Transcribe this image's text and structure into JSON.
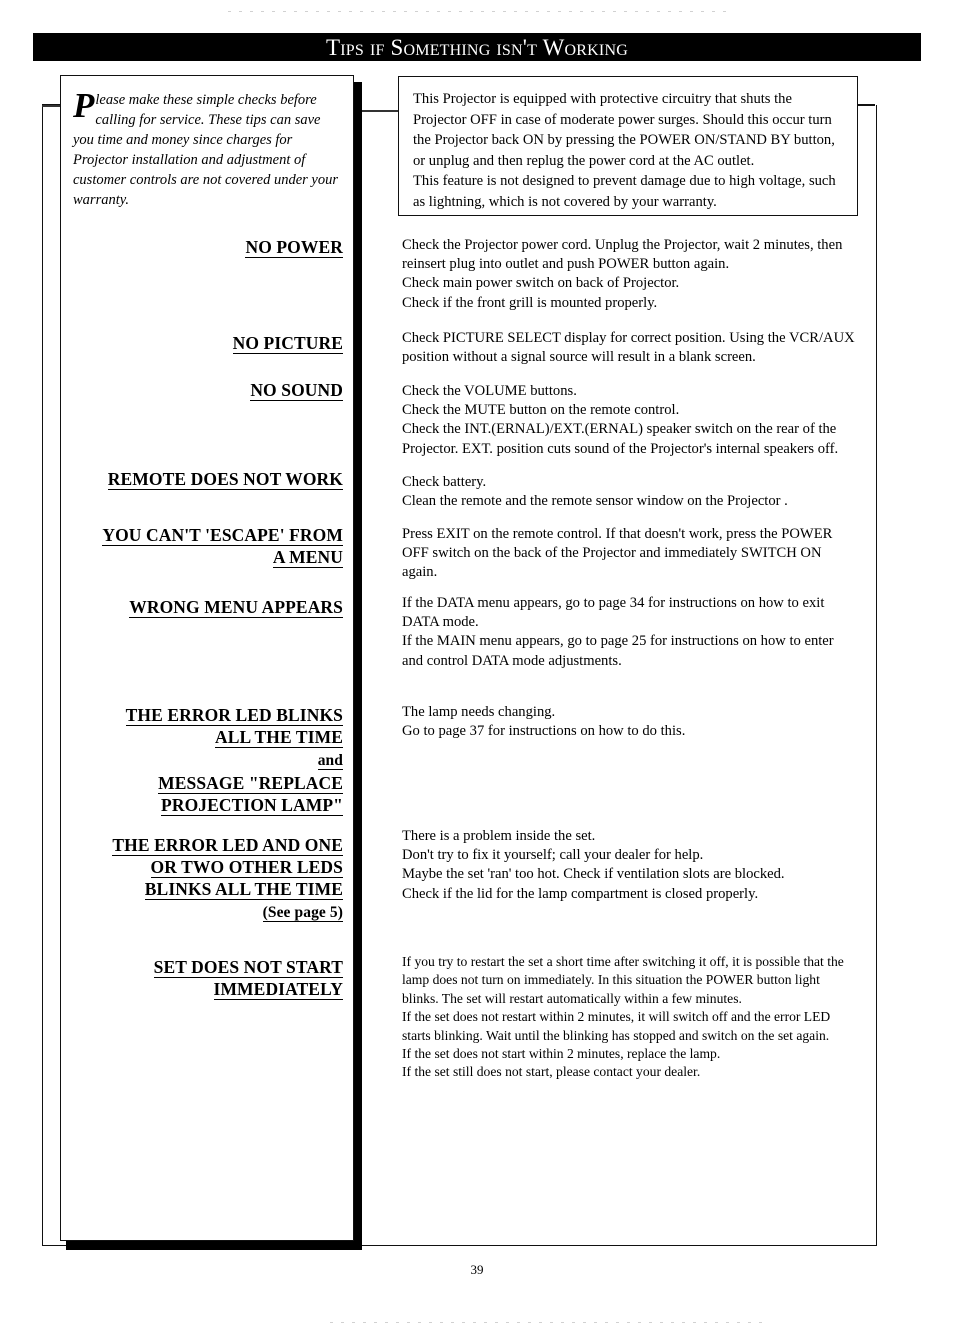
{
  "page": {
    "banner_title": "Tips if Something isn't Working",
    "page_number": "39"
  },
  "intro": {
    "dropcap": "P",
    "text": "lease make these simple checks before calling for service. These tips can save you time and money since charges for Projector installation and adjustment of customer controls are not covered under your warranty."
  },
  "note_box": {
    "line1": "This Projector is equipped with protective circuitry that shuts the Projector OFF in case of moderate power surges. Should this occur turn the Projector back ON by pressing the POWER ON/STAND BY button, or unplug and then replug the power cord at the AC outlet.",
    "line2": "This feature is not designed to prevent damage due to high voltage, such as lightning, which is not covered by your warranty."
  },
  "sections": [
    {
      "heading_lines": [
        "NO  POWER"
      ],
      "body": [
        "Check the Projector power cord. Unplug the Projector, wait 2 minutes, then reinsert plug into outlet and push POWER button again.",
        "Check main power switch on back of Projector.",
        "Check if the front grill is mounted properly."
      ]
    },
    {
      "heading_lines": [
        "NO  PICTURE"
      ],
      "body": [
        "Check PICTURE SELECT display for correct position. Using the VCR/AUX position without a signal source will result in a blank screen."
      ]
    },
    {
      "heading_lines": [
        "NO  SOUND"
      ],
      "body": [
        "Check the VOLUME buttons.",
        "Check the MUTE button on the remote control.",
        "Check the INT.(ERNAL)/EXT.(ERNAL) speaker switch on the rear of the Projector. EXT. position cuts sound of the Projector's internal speakers off."
      ]
    },
    {
      "heading_lines": [
        "REMOTE DOES NOT WORK"
      ],
      "body": [
        "Check battery.",
        "Clean the remote and the remote sensor window on the Projector ."
      ]
    },
    {
      "heading_lines": [
        "YOU CAN'T 'ESCAPE' FROM",
        "A MENU"
      ],
      "body": [
        "Press EXIT on the remote control. If that doesn't work, press the POWER OFF switch on the back of the Projector and immediately SWITCH ON again."
      ]
    },
    {
      "heading_lines": [
        "WRONG MENU APPEARS"
      ],
      "body": [
        "If the DATA menu appears, go to page 34 for instructions on how to exit DATA mode.",
        "If the MAIN menu appears, go to page 25 for instructions on how to enter and control DATA mode adjustments."
      ]
    },
    {
      "heading_lines": [
        "THE ERROR LED BLINKS",
        "ALL THE TIME",
        "and",
        "MESSAGE \"REPLACE",
        "PROJECTION LAMP\""
      ],
      "body": [
        "The lamp needs changing.",
        "Go to page 37 for instructions on how to do this."
      ]
    },
    {
      "heading_lines": [
        "THE ERROR LED AND ONE",
        "OR TWO OTHER LEDS",
        "BLINKS ALL THE TIME",
        "(See page 5)"
      ],
      "body": [
        "There is a problem inside the set.",
        "Don't try to fix it yourself; call your dealer for help.",
        "Maybe the set 'ran' too hot. Check if ventilation slots are blocked.",
        "Check if the lid for the lamp compartment is closed properly."
      ]
    },
    {
      "heading_lines": [
        "SET DOES NOT START",
        "IMMEDIATELY"
      ],
      "body": [
        "If you try to restart the set a short time after switching it off, it is possible that the lamp does not turn on immediately. In this situation the POWER button light blinks. The set will restart automatically within a few minutes.",
        "If the set does not restart within 2 minutes, it will switch off and the error LED starts blinking. Wait until the blinking has stopped and switch on the set again.",
        "If the set does not start within 2 minutes, replace the lamp.",
        "If the set still does not start, please contact your dealer."
      ]
    }
  ]
}
